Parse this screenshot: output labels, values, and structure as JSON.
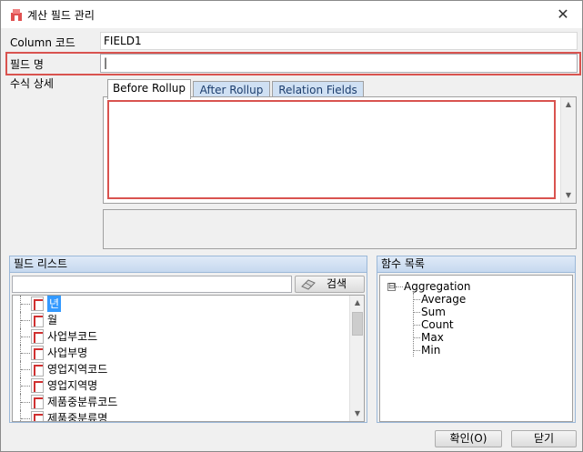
{
  "window": {
    "title": "계산 필드 관리",
    "close_symbol": "✕"
  },
  "form": {
    "column_code_label": "Column 코드",
    "column_code_value": "FIELD1",
    "field_name_label": "필드 명",
    "field_name_value": "|",
    "formula_label": "수식 상세"
  },
  "tabs": [
    {
      "label": "Before Rollup"
    },
    {
      "label": "After Rollup"
    },
    {
      "label": "Relation Fields"
    }
  ],
  "field_list": {
    "header": "필드 리스트",
    "search_value": "",
    "search_button_label": "검색",
    "items": [
      {
        "label": "년"
      },
      {
        "label": "월"
      },
      {
        "label": "사업부코드"
      },
      {
        "label": "사업부명"
      },
      {
        "label": "영업지역코드"
      },
      {
        "label": "영업지역명"
      },
      {
        "label": "제품중분류코드"
      },
      {
        "label": "제품중분류명"
      }
    ]
  },
  "function_list": {
    "header": "함수 목록",
    "root": {
      "label": "Aggregation",
      "expander": "⊟"
    },
    "children": [
      {
        "label": "Average"
      },
      {
        "label": "Sum"
      },
      {
        "label": "Count"
      },
      {
        "label": "Max"
      },
      {
        "label": "Min"
      }
    ]
  },
  "footer": {
    "ok_label": "확인(O)",
    "close_label": "닫기"
  },
  "colors": {
    "highlight": "#d9534f",
    "selection": "#3399ff",
    "group_header": "#c6d9ef"
  }
}
